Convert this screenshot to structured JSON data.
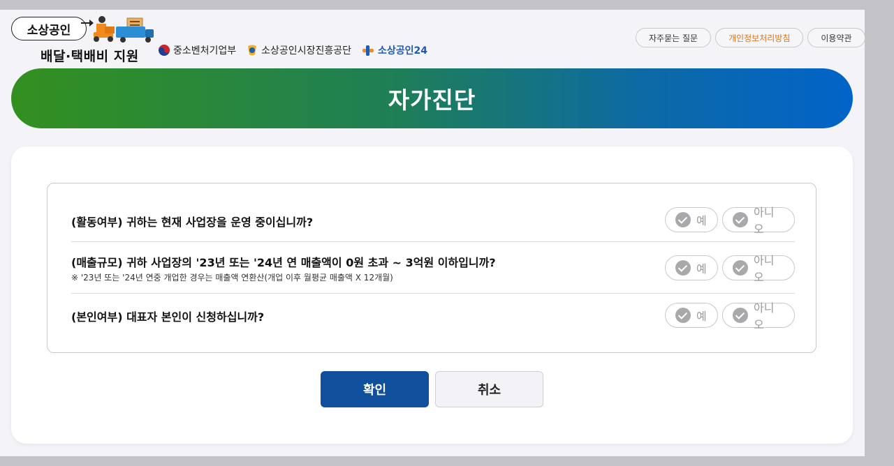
{
  "header": {
    "logo_title": "소상공인",
    "logo_subtitle": "배달·택배비 지원",
    "orgs": [
      "중소벤처기업부",
      "소상공인시장진흥공단",
      "소상공인24"
    ],
    "links": [
      "자주묻는 질문",
      "개인정보처리방침",
      "이용약관"
    ]
  },
  "banner": {
    "title": "자가진단"
  },
  "questions": [
    {
      "text": "(활동여부) 귀하는 현재 사업장을 운영 중이십니까?",
      "note": "",
      "yes": "예",
      "no": "아니오"
    },
    {
      "text": "(매출규모) 귀하 사업장의 '23년 또는 '24년 연 매출액이 0원 초과 ~ 3억원 이하입니까?",
      "note": "※ '23년 또는 '24년 연중 개업한 경우는 매출액 연환산(개업 이후 월평균 매출액 X 12개월)",
      "yes": "예",
      "no": "아니오"
    },
    {
      "text": "(본인여부) 대표자 본인이 신청하십니까?",
      "note": "",
      "yes": "예",
      "no": "아니오"
    }
  ],
  "actions": {
    "confirm": "확인",
    "cancel": "취소"
  },
  "colors": {
    "accent": "#0f4f9c",
    "banner_start": "#33901f",
    "banner_end": "#0263c9",
    "highlight_link": "#d9741c"
  }
}
